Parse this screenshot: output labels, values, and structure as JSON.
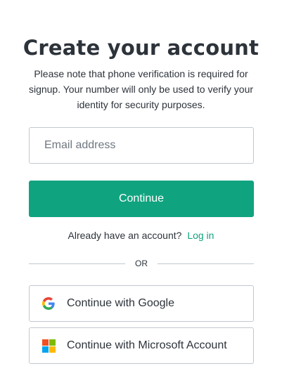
{
  "header": {
    "title": "Create your account",
    "subtitle": "Please note that phone verification is required for signup. Your number will only be used to verify your identity for security purposes."
  },
  "form": {
    "email_placeholder": "Email address",
    "email_value": "",
    "continue_label": "Continue"
  },
  "login": {
    "prompt": "Already have an account?",
    "link_label": "Log in"
  },
  "divider": {
    "label": "OR"
  },
  "social": {
    "google_label": "Continue with Google",
    "microsoft_label": "Continue with Microsoft Account"
  },
  "colors": {
    "accent": "#10a37f",
    "text": "#2d333a",
    "border": "#c2c8d0",
    "google_blue": "#4285F4",
    "google_red": "#EA4335",
    "google_yellow": "#FBBC05",
    "google_green": "#34A853",
    "ms_red": "#F25022",
    "ms_green": "#7FBA00",
    "ms_blue": "#00A4EF",
    "ms_yellow": "#FFB900"
  },
  "icons": {
    "google": "google-logo-icon",
    "microsoft": "microsoft-logo-icon"
  }
}
